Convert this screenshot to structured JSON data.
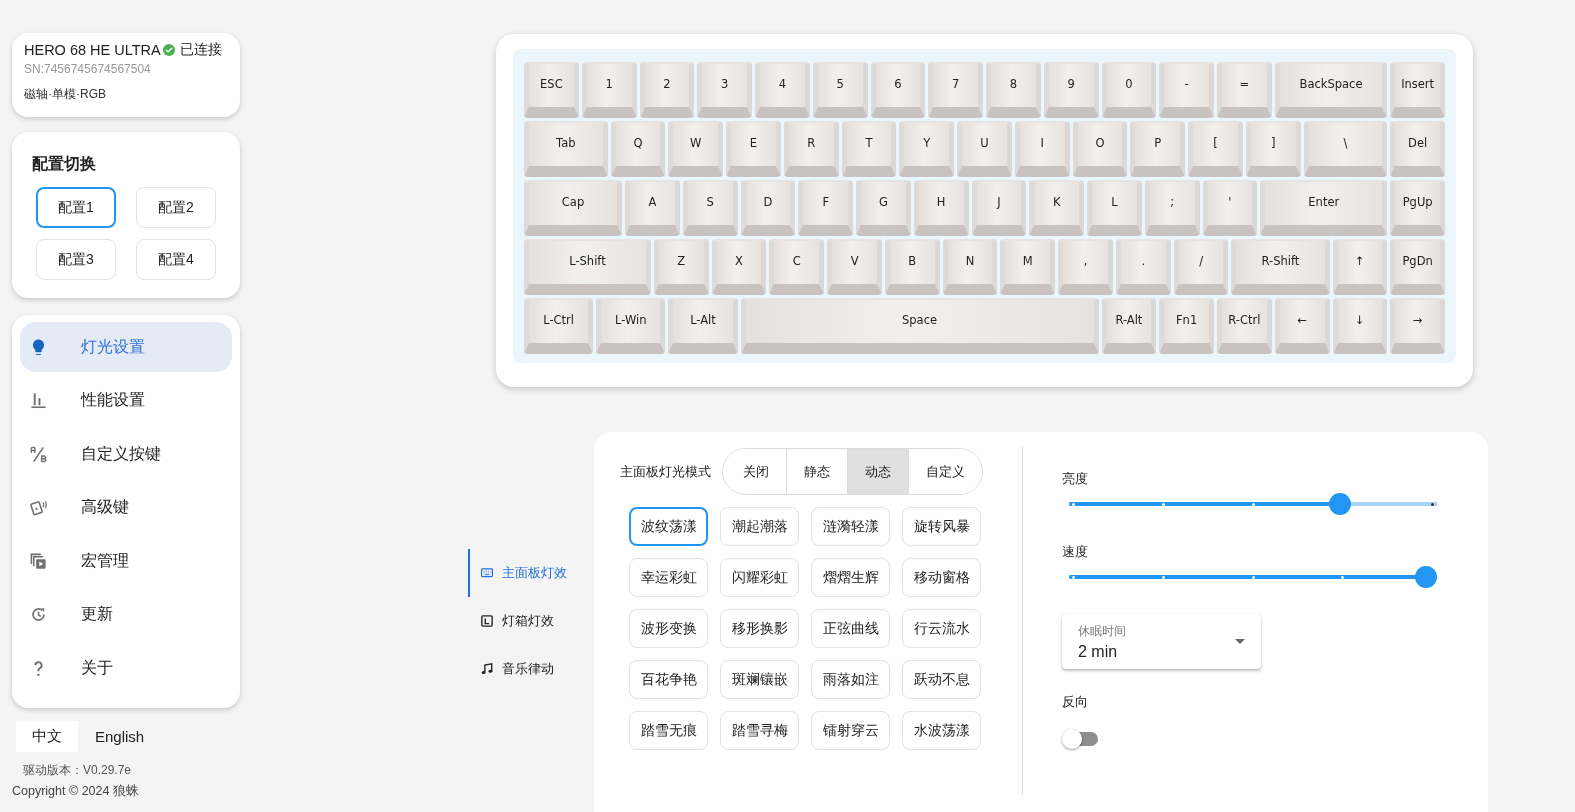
{
  "device": {
    "name": "HERO 68 HE ULTRA",
    "connected": true,
    "status": "已连接",
    "serial": "SN:7456745674567504",
    "spec": "磁轴·单模·RGB"
  },
  "profiles": {
    "title": "配置切换",
    "items": [
      {
        "label": "配置1",
        "selected": true
      },
      {
        "label": "配置2",
        "selected": false
      },
      {
        "label": "配置3",
        "selected": false
      },
      {
        "label": "配置4",
        "selected": false
      }
    ]
  },
  "nav": {
    "items": [
      {
        "label": "灯光设置",
        "selected": true
      },
      {
        "label": "性能设置",
        "selected": false
      },
      {
        "label": "自定义按键",
        "selected": false
      },
      {
        "label": "高级键",
        "selected": false
      },
      {
        "label": "宏管理",
        "selected": false
      },
      {
        "label": "更新",
        "selected": false
      },
      {
        "label": "关于",
        "selected": false
      }
    ]
  },
  "languages": [
    {
      "label": "中文",
      "selected": true
    },
    {
      "label": "English",
      "selected": false
    }
  ],
  "footer": {
    "version": "驱动版本：V0.29.7e",
    "copyright": "Copyright © 2024 狼蛛"
  },
  "keyboard": {
    "rows": [
      {
        "keys": [
          "ESC",
          "1",
          "2",
          "3",
          "4",
          "5",
          "6",
          "7",
          "8",
          "9",
          "0",
          "-",
          "=",
          "BackSpace",
          "Insert"
        ]
      },
      {
        "keys": [
          "Tab",
          "Q",
          "W",
          "E",
          "R",
          "T",
          "Y",
          "U",
          "I",
          "O",
          "P",
          "[",
          "]",
          "\\",
          "Del"
        ]
      },
      {
        "keys": [
          "Cap",
          "A",
          "S",
          "D",
          "F",
          "G",
          "H",
          "J",
          "K",
          "L",
          ";",
          "'",
          "Enter",
          "PgUp"
        ]
      },
      {
        "keys": [
          "L-Shift",
          "Z",
          "X",
          "C",
          "V",
          "B",
          "N",
          "M",
          ",",
          ".",
          "/",
          "R-Shift",
          "↑",
          "PgDn"
        ]
      },
      {
        "keys": [
          "L-Ctrl",
          "L-Win",
          "L-Alt",
          "Space",
          "R-Alt",
          "Fn1",
          "R-Ctrl",
          "←",
          "↓",
          "→"
        ]
      }
    ]
  },
  "lighting": {
    "subnav": [
      {
        "label": "主面板灯效",
        "selected": true
      },
      {
        "label": "灯箱灯效",
        "selected": false
      },
      {
        "label": "音乐律动",
        "selected": false
      }
    ],
    "mode_label": "主面板灯光模式",
    "modes": [
      {
        "label": "关闭",
        "selected": false
      },
      {
        "label": "静态",
        "selected": false
      },
      {
        "label": "动态",
        "selected": true
      },
      {
        "label": "自定义",
        "selected": false
      }
    ],
    "effects": [
      {
        "label": "波纹荡漾",
        "selected": true
      },
      {
        "label": "潮起潮落",
        "selected": false
      },
      {
        "label": "涟漪轻漾",
        "selected": false
      },
      {
        "label": "旋转风暴",
        "selected": false
      },
      {
        "label": "幸运彩虹",
        "selected": false
      },
      {
        "label": "闪耀彩虹",
        "selected": false
      },
      {
        "label": "熠熠生辉",
        "selected": false
      },
      {
        "label": "移动窗格",
        "selected": false
      },
      {
        "label": "波形变换",
        "selected": false
      },
      {
        "label": "移形换影",
        "selected": false
      },
      {
        "label": "正弦曲线",
        "selected": false
      },
      {
        "label": "行云流水",
        "selected": false
      },
      {
        "label": "百花争艳",
        "selected": false
      },
      {
        "label": "斑斓镶嵌",
        "selected": false
      },
      {
        "label": "雨落如注",
        "selected": false
      },
      {
        "label": "跃动不息",
        "selected": false
      },
      {
        "label": "踏雪无痕",
        "selected": false
      },
      {
        "label": "踏雪寻梅",
        "selected": false
      },
      {
        "label": "镭射穿云",
        "selected": false
      },
      {
        "label": "水波荡漾",
        "selected": false
      }
    ],
    "brightness": {
      "label": "亮度",
      "level": 0.75
    },
    "speed": {
      "label": "速度",
      "level": 1
    },
    "sleep": {
      "label": "休眠时间",
      "value": "2 min"
    },
    "reverse": {
      "label": "反向",
      "on": false
    }
  }
}
